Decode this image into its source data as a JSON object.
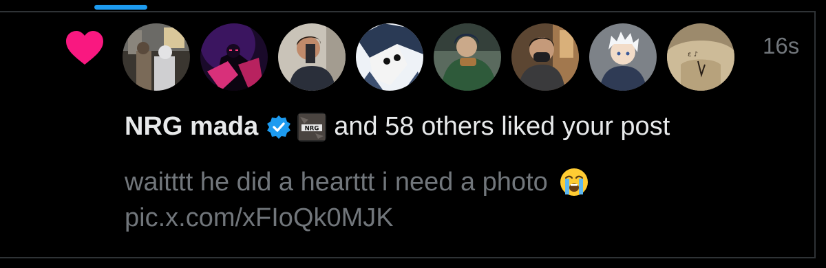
{
  "notification": {
    "icon": "heart-icon",
    "timestamp": "16s",
    "liker_name": "NRG mada",
    "verified_icon": "verified-badge-icon",
    "org_badge_text": "NRG",
    "liked_text": "and 58 others liked your post",
    "post_text": "waitttt he did a hearttt i need a photo",
    "post_emoji": "loudly-crying-face-emoji",
    "post_link": "pic.x.com/xFIoQk0MJK"
  },
  "avatars": [
    {
      "name": "avatar-1"
    },
    {
      "name": "avatar-2"
    },
    {
      "name": "avatar-3"
    },
    {
      "name": "avatar-4"
    },
    {
      "name": "avatar-5"
    },
    {
      "name": "avatar-6"
    },
    {
      "name": "avatar-7"
    },
    {
      "name": "avatar-8"
    }
  ],
  "colors": {
    "background": "#000000",
    "heart": "#f91880",
    "accent": "#1d9bf0",
    "primary_text": "#e7e9ea",
    "secondary_text": "#71767b",
    "divider": "#2f3336"
  }
}
